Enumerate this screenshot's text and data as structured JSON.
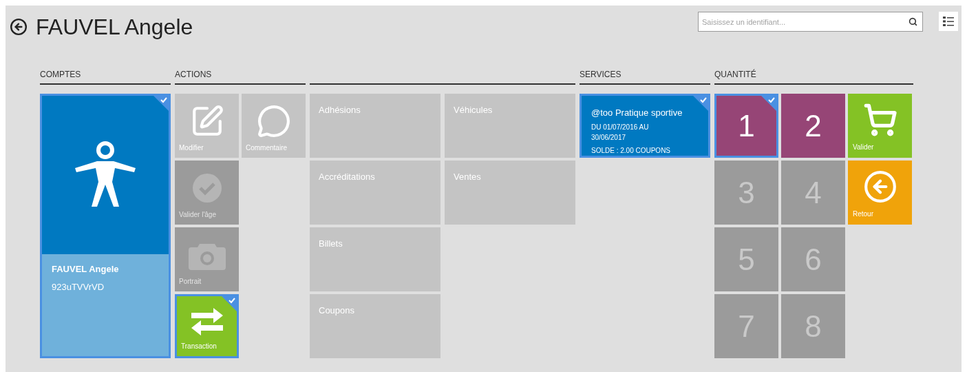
{
  "header": {
    "title": "FAUVEL Angele",
    "search": {
      "placeholder": "Saisissez un identifiant..."
    }
  },
  "sections": {
    "accounts": "COMPTES",
    "actions": "ACTIONS",
    "services": "SERVICES",
    "quantity": "QUANTITÉ"
  },
  "account": {
    "name": "FAUVEL Angele",
    "id": "923uTVVrVD",
    "selected": true
  },
  "actions": [
    {
      "label": "Modifier",
      "kind": "edit",
      "color": "#c4c4c4",
      "disabled": false,
      "selected": false
    },
    {
      "label": "Commentaire",
      "kind": "comment",
      "color": "#c4c4c4",
      "disabled": false,
      "selected": false
    },
    {
      "label": "Valider l'âge",
      "kind": "check",
      "color": "#9b9b9b",
      "disabled": true,
      "selected": false
    },
    {
      "label": "Portrait",
      "kind": "camera",
      "color": "#9b9b9b",
      "disabled": true,
      "selected": false
    },
    {
      "label": "Transaction",
      "kind": "transfer",
      "color": "#84c225",
      "disabled": false,
      "selected": true
    }
  ],
  "categories": [
    [
      "Adhésions",
      "Véhicules"
    ],
    [
      "Accréditations",
      "Ventes"
    ],
    [
      "Billets"
    ],
    [
      "Coupons"
    ]
  ],
  "services": [
    {
      "title": "@too Pratique sportive",
      "period": "DU 01/07/2016 AU 30/06/2017",
      "balance": "SOLDE : 2.00 COUPONS",
      "selected": true
    }
  ],
  "quantities": [
    {
      "label": "1",
      "selected": true,
      "disabled": false
    },
    {
      "label": "2",
      "selected": false,
      "disabled": false
    },
    {
      "label": "3",
      "selected": false,
      "disabled": true
    },
    {
      "label": "4",
      "selected": false,
      "disabled": true
    },
    {
      "label": "5",
      "selected": false,
      "disabled": true
    },
    {
      "label": "6",
      "selected": false,
      "disabled": true
    },
    {
      "label": "7",
      "selected": false,
      "disabled": true
    },
    {
      "label": "8",
      "selected": false,
      "disabled": true
    }
  ],
  "commands": [
    {
      "label": "Valider",
      "kind": "cart"
    },
    {
      "label": "Retour",
      "kind": "back"
    }
  ]
}
